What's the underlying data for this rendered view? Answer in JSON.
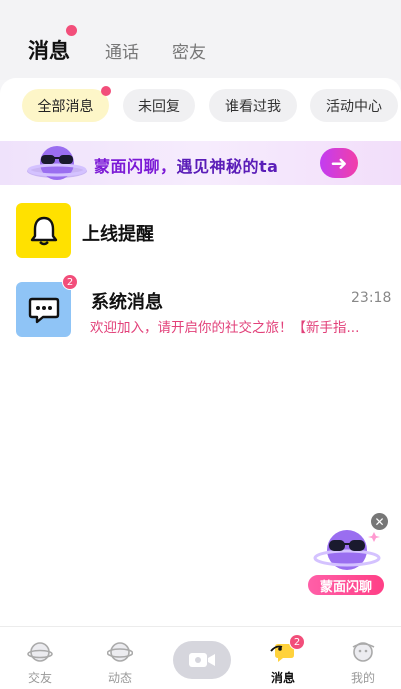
{
  "header": {
    "tabs": [
      {
        "label": "消息",
        "active": true,
        "dot": true
      },
      {
        "label": "通话",
        "active": false
      },
      {
        "label": "密友",
        "active": false
      }
    ]
  },
  "filters": [
    {
      "label": "全部消息",
      "active": true,
      "dot": true
    },
    {
      "label": "未回复",
      "active": false
    },
    {
      "label": "谁看过我",
      "active": false
    },
    {
      "label": "活动中心",
      "active": false
    }
  ],
  "banner": {
    "text_main": "蒙面闪聊，",
    "text_tail": "遇见神秘的ta",
    "arrow": "➜"
  },
  "rows": [
    {
      "title": "上线提醒",
      "icon": "bell-icon",
      "icon_color": "#ffe100"
    },
    {
      "title": "系统消息",
      "icon": "chat-bubble-icon",
      "icon_color": "#8fc4f6",
      "time": "23:18",
      "preview": "欢迎加入，请开启你的社交之旅！【新手指...",
      "badge": "2"
    }
  ],
  "floating_promo": {
    "label": "蒙面闪聊",
    "close": "✕"
  },
  "bottom_nav": [
    {
      "label": "交友",
      "icon": "planet-icon",
      "active": false
    },
    {
      "label": "动态",
      "icon": "planet-ring-icon",
      "active": false
    },
    {
      "label": "",
      "icon": "video-camera-icon",
      "active": false
    },
    {
      "label": "消息",
      "icon": "message-icon",
      "active": true,
      "badge": "2"
    },
    {
      "label": "我的",
      "icon": "profile-planet-icon",
      "active": false
    }
  ],
  "colors": {
    "accent_pink": "#f24e7a",
    "banner_purple": "#7c1ad6",
    "chip_active": "#fdf6c8"
  }
}
